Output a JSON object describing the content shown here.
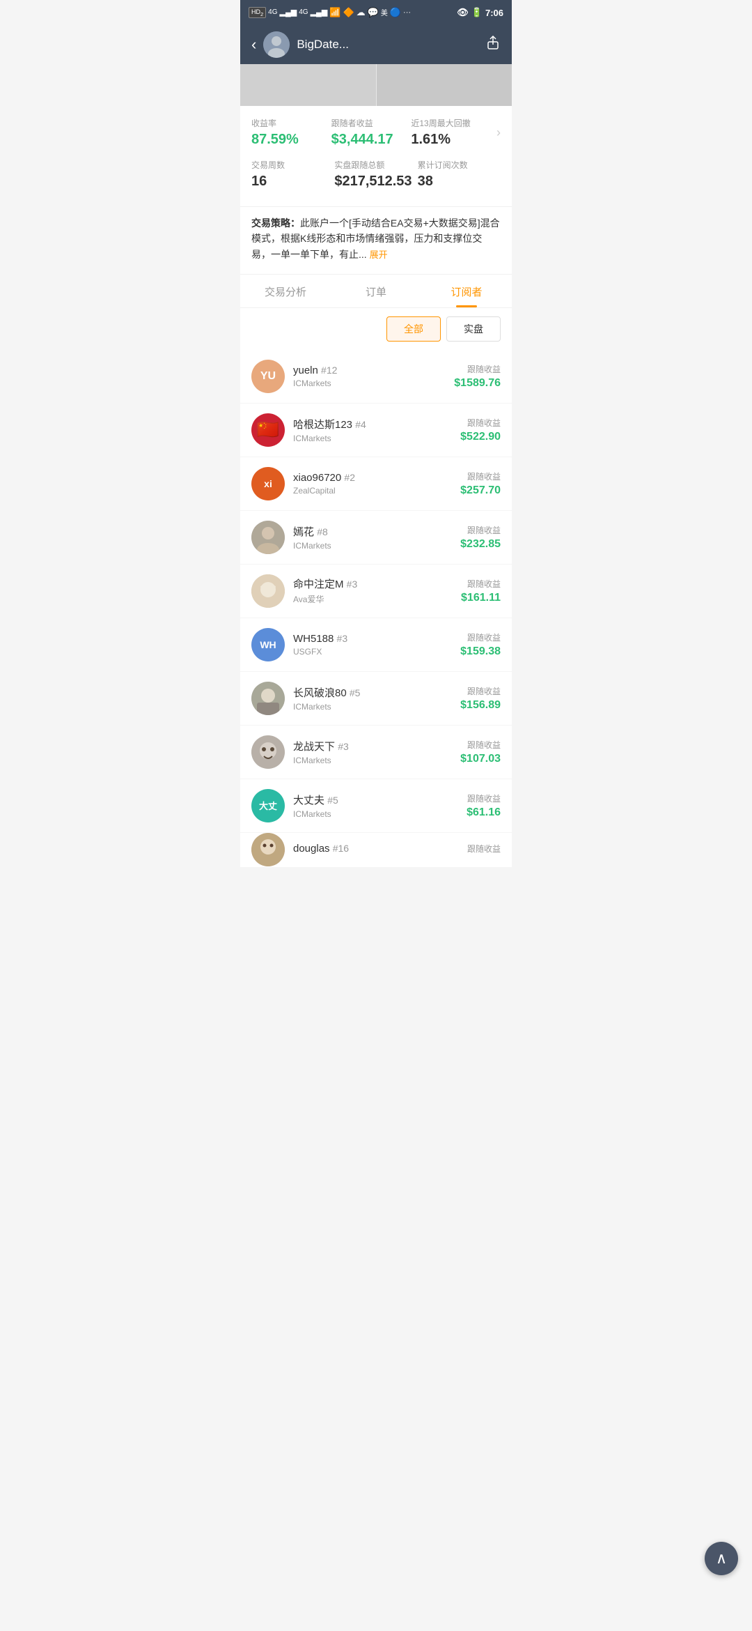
{
  "statusBar": {
    "left": "HD₂ 4G ᵒᵒ 4G",
    "time": "7:06",
    "battery": "■"
  },
  "header": {
    "title": "BigDate...",
    "backLabel": "‹",
    "shareIcon": "⬆"
  },
  "stats": {
    "row1": [
      {
        "label": "收益率",
        "value": "87.59%",
        "color": "green"
      },
      {
        "label": "跟随者收益",
        "value": "$3,444.17",
        "color": "green"
      },
      {
        "label": "近13周最大回撤",
        "value": "1.61%",
        "color": "black"
      }
    ],
    "row2": [
      {
        "label": "交易周数",
        "value": "16",
        "color": "black"
      },
      {
        "label": "实盘跟随总额",
        "value": "$217,512.53",
        "color": "black"
      },
      {
        "label": "累计订阅次数",
        "value": "38",
        "color": "black"
      }
    ]
  },
  "strategy": {
    "prefix": "交易策略：",
    "text": "此账户一个[手动结合EA交易+大数据交易]混合模式，根据K线形态和市场情绪强弱，压力和支撑位交易，一单一单下单，有止...",
    "expandLabel": "展开"
  },
  "tabs": [
    {
      "id": "analysis",
      "label": "交易分析",
      "active": false
    },
    {
      "id": "orders",
      "label": "订单",
      "active": false
    },
    {
      "id": "subscribers",
      "label": "订阅者",
      "active": true
    }
  ],
  "filters": [
    {
      "id": "all",
      "label": "全部",
      "active": true
    },
    {
      "id": "real",
      "label": "实盘",
      "active": false
    }
  ],
  "subscribers": [
    {
      "id": 1,
      "name": "yueln",
      "rank": "#12",
      "broker": "ICMarkets",
      "earningsLabel": "跟随收益",
      "earnings": "$1589.76",
      "avatarText": "YU",
      "avatarBg": "#e8a87c",
      "avatarType": "text"
    },
    {
      "id": 2,
      "name": "哈根达斯123",
      "rank": "#4",
      "broker": "ICMarkets",
      "earningsLabel": "跟随收益",
      "earnings": "$522.90",
      "avatarText": "🇨🇳",
      "avatarBg": "#cc2233",
      "avatarType": "flag"
    },
    {
      "id": 3,
      "name": "xiao96720",
      "rank": "#2",
      "broker": "ZealCapital",
      "earningsLabel": "跟随收益",
      "earnings": "$257.70",
      "avatarText": "xi",
      "avatarBg": "#e05c20",
      "avatarType": "text"
    },
    {
      "id": 4,
      "name": "嫣花",
      "rank": "#8",
      "broker": "ICMarkets",
      "earningsLabel": "跟随收益",
      "earnings": "$232.85",
      "avatarText": "🌸",
      "avatarBg": "#9a9a9a",
      "avatarType": "photo"
    },
    {
      "id": 5,
      "name": "命中注定M",
      "rank": "#3",
      "broker": "Ava爱华",
      "earningsLabel": "跟随收益",
      "earnings": "$161.11",
      "avatarText": "👶",
      "avatarBg": "#c0b090",
      "avatarType": "photo"
    },
    {
      "id": 6,
      "name": "WH5188",
      "rank": "#3",
      "broker": "USGFX",
      "earningsLabel": "跟随收益",
      "earnings": "$159.38",
      "avatarText": "WH",
      "avatarBg": "#5b8dd9",
      "avatarType": "text"
    },
    {
      "id": 7,
      "name": "长风破浪80",
      "rank": "#5",
      "broker": "ICMarkets",
      "earningsLabel": "跟随收益",
      "earnings": "$156.89",
      "avatarText": "🐶",
      "avatarBg": "#a0a0a0",
      "avatarType": "photo"
    },
    {
      "id": 8,
      "name": "龙战天下",
      "rank": "#3",
      "broker": "ICMarkets",
      "earningsLabel": "跟随收益",
      "earnings": "$107.03",
      "avatarText": "🐕",
      "avatarBg": "#b0b0b0",
      "avatarType": "photo"
    },
    {
      "id": 9,
      "name": "大丈夫",
      "rank": "#5",
      "broker": "ICMarkets",
      "earningsLabel": "跟随收益",
      "earnings": "$61.16",
      "avatarText": "大丈",
      "avatarBg": "#2abaa4",
      "avatarType": "text"
    },
    {
      "id": 10,
      "name": "douglas",
      "rank": "#16",
      "broker": "",
      "earningsLabel": "跟随收益",
      "earnings": "",
      "avatarText": "🐻",
      "avatarBg": "#c0a080",
      "avatarType": "photo",
      "partial": true
    }
  ],
  "scrollTopBtn": "∧"
}
